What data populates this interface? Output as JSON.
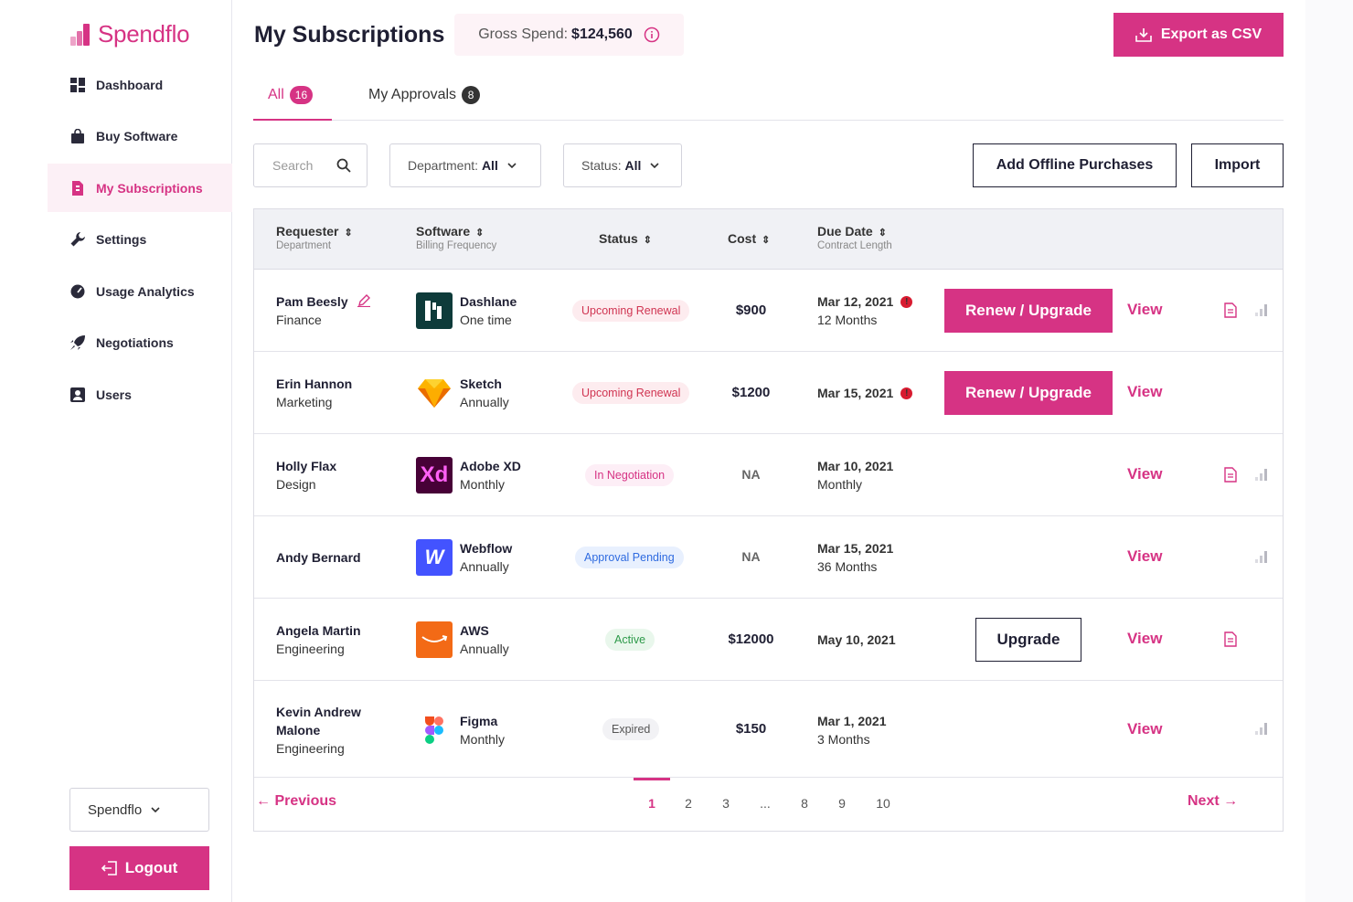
{
  "brand": {
    "name": "Spendflo"
  },
  "sidebar": {
    "items": [
      {
        "label": "Dashboard",
        "icon": "grid-icon"
      },
      {
        "label": "Buy Software",
        "icon": "bag-icon"
      },
      {
        "label": "My Subscriptions",
        "icon": "document-icon"
      },
      {
        "label": "Settings",
        "icon": "wrench-icon"
      },
      {
        "label": "Usage Analytics",
        "icon": "gauge-icon"
      },
      {
        "label": "Negotiations",
        "icon": "rocket-icon"
      },
      {
        "label": "Users",
        "icon": "user-card-icon"
      }
    ],
    "org": "Spendflo",
    "logout": "Logout"
  },
  "header": {
    "title": "My Subscriptions",
    "gross_label": "Gross Spend:",
    "gross_value": "$124,560",
    "export": "Export as CSV"
  },
  "tabs": [
    {
      "label": "All",
      "count": "16"
    },
    {
      "label": "My Approvals",
      "count": "8"
    }
  ],
  "filters": {
    "search_placeholder": "Search",
    "dept_label": "Department:",
    "dept_value": "All",
    "status_label": "Status:",
    "status_value": "All",
    "add_offline": "Add Offline Purchases",
    "import": "Import"
  },
  "table": {
    "headers": {
      "requester": "Requester",
      "requester_sub": "Department",
      "software": "Software",
      "software_sub": "Billing Frequency",
      "status": "Status",
      "cost": "Cost",
      "due": "Due Date",
      "due_sub": "Contract Length"
    },
    "rows": [
      {
        "name": "Pam Beesly",
        "dept": "Finance",
        "software": "Dashlane",
        "freq": "One time",
        "status": "Upcoming Renewal",
        "cost": "$900",
        "due": "Mar 12, 2021",
        "length": "12 Months",
        "action": "Renew / Upgrade",
        "view": "View"
      },
      {
        "name": "Erin Hannon",
        "dept": "Marketing",
        "software": "Sketch",
        "freq": "Annually",
        "status": "Upcoming Renewal",
        "cost": "$1200",
        "due": "Mar 15, 2021",
        "length": "",
        "action": "Renew / Upgrade",
        "view": "View"
      },
      {
        "name": "Holly Flax",
        "dept": "Design",
        "software": "Adobe XD",
        "freq": "Monthly",
        "status": "In Negotiation",
        "cost": "NA",
        "due": "Mar 10, 2021",
        "length": "Monthly",
        "action": "",
        "view": "View"
      },
      {
        "name": "Andy Bernard",
        "dept": "",
        "software": "Webflow",
        "freq": "Annually",
        "status": "Approval Pending",
        "cost": "NA",
        "due": "Mar 15, 2021",
        "length": "36 Months",
        "action": "",
        "view": "View"
      },
      {
        "name": "Angela Martin",
        "dept": "Engineering",
        "software": "AWS",
        "freq": "Annually",
        "status": "Active",
        "cost": "$12000",
        "due": "May 10, 2021",
        "length": "",
        "action": "Upgrade",
        "view": "View"
      },
      {
        "name_line1": "Kevin Andrew",
        "name_line2": "Malone",
        "dept": "Engineering",
        "software": "Figma",
        "freq": "Monthly",
        "status": "Expired",
        "cost": "$150",
        "due": "Mar 1, 2021",
        "length": "3 Months",
        "action": "",
        "view": "View"
      }
    ],
    "logos": {
      "dashlane": "Dx",
      "adobe": "Xd",
      "webflow": "W"
    }
  },
  "pagination": {
    "prev": "Previous",
    "next": "Next",
    "pages": [
      "1",
      "2",
      "3",
      "...",
      "8",
      "9",
      "10"
    ],
    "current": "1"
  },
  "colors": {
    "accent": "#d63384",
    "alert": "#d81b30"
  }
}
